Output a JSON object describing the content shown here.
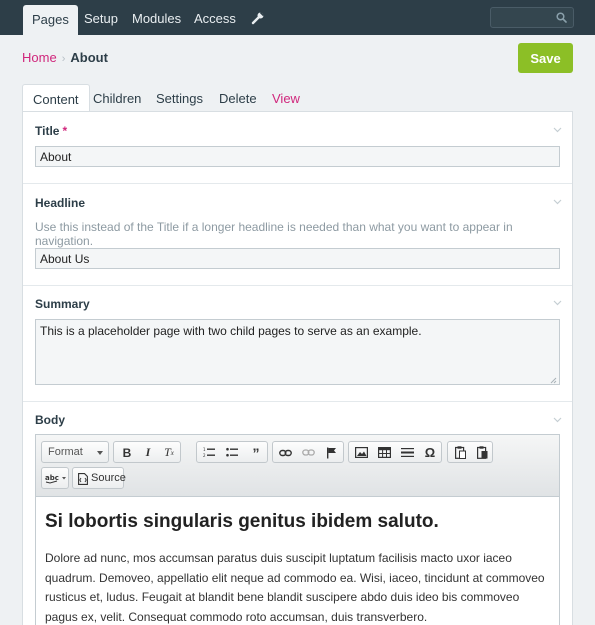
{
  "nav": {
    "items": [
      {
        "label": "Pages",
        "active": true
      },
      {
        "label": "Setup",
        "active": false
      },
      {
        "label": "Modules",
        "active": false
      },
      {
        "label": "Access",
        "active": false
      }
    ],
    "search_placeholder": ""
  },
  "breadcrumb": {
    "home": "Home",
    "separator": "›",
    "current": "About"
  },
  "save_label": "Save",
  "tabs": [
    {
      "label": "Content",
      "active": true
    },
    {
      "label": "Children",
      "active": false
    },
    {
      "label": "Settings",
      "active": false
    },
    {
      "label": "Delete",
      "active": false
    },
    {
      "label": "View",
      "active": false
    }
  ],
  "fields": {
    "title": {
      "label": "Title",
      "required_mark": "*",
      "value": "About"
    },
    "headline": {
      "label": "Headline",
      "description": "Use this instead of the Title if a longer headline is needed than what you want to appear in navigation.",
      "value": "About Us"
    },
    "summary": {
      "label": "Summary",
      "value": "This is a placeholder page with two child pages to serve as an example."
    },
    "body": {
      "label": "Body",
      "format_label": "Format",
      "source_label": "Source",
      "heading": "Si lobortis singularis genitus ibidem saluto.",
      "paragraph": "Dolore ad nunc, mos accumsan paratus duis suscipit luptatum facilisis macto uxor iaceo quadrum. Demoveo, appellatio elit neque ad commodo ea. Wisi, iaceo, tincidunt at commoveo rusticus et, ludus. Feugait at blandit bene blandit suscipere abdo duis ideo bis commoveo pagus ex, velit. Consequat commodo roto accumsan, duis transverbero."
    }
  },
  "colors": {
    "nav_bg": "#2d3e48",
    "accent": "#d0277c",
    "save": "#8cbf26"
  }
}
